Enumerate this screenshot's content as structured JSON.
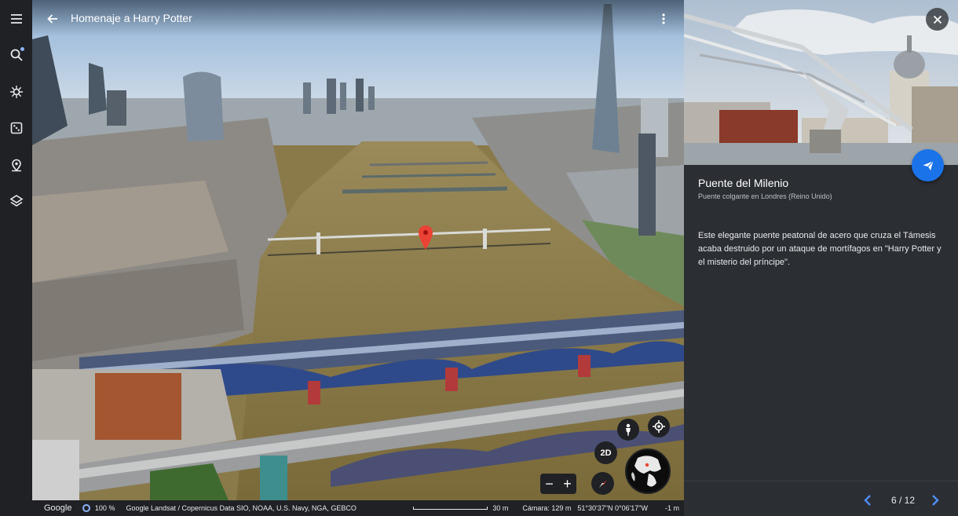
{
  "app": {
    "title": "Homenaje a Harry Potter"
  },
  "rail": {
    "items": [
      "menu-icon",
      "search-icon",
      "voyager-icon",
      "feeling-lucky-icon",
      "projects-icon",
      "map-style-icon"
    ]
  },
  "map_controls": {
    "toggle_2d": "2D",
    "zoom_out": "−",
    "zoom_in": "+"
  },
  "status": {
    "brand": "Google",
    "progress": "100 %",
    "attribution": "Google  Landsat / Copernicus  Data SIO, NOAA, U.S. Navy, NGA, GEBCO",
    "scale": "30 m",
    "camera": "Cámara: 129 m",
    "coords": "51°30'37\"N 0°06'17\"W",
    "elevation": "-1 m"
  },
  "panel": {
    "title": "Puente del Milenio",
    "subtitle": "Puente colgante en Londres (Reino Unido)",
    "description": "Este elegante puente peatonal de acero que cruza el Támesis acaba destruido por un ataque de mortífagos en \"Harry Potter y el misterio del príncipe\".",
    "counter": "6 / 12"
  },
  "colors": {
    "accent": "#1a73e8",
    "panel_bg": "#2b2e33",
    "rail_bg": "#202124",
    "pin": "#ea4335",
    "nav_arrow": "#8ab4f8"
  }
}
